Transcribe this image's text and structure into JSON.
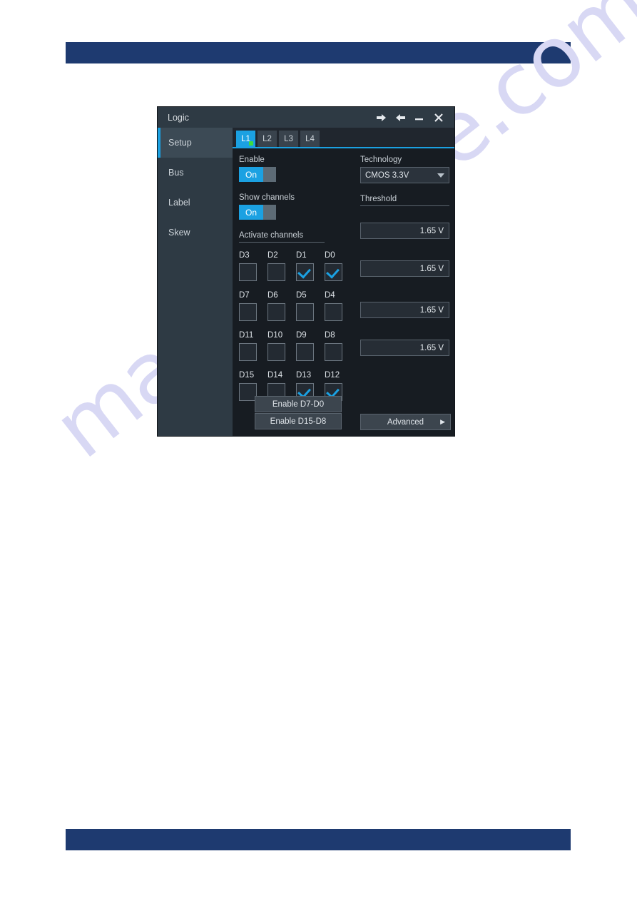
{
  "page": {
    "watermark": "manualshive.com",
    "bar_color": "#1e3a70"
  },
  "window": {
    "title": "Logic",
    "titlebar_buttons": [
      {
        "name": "back-arrow",
        "glyph": "←"
      },
      {
        "name": "forward-arrow",
        "glyph": "→"
      },
      {
        "name": "minimize",
        "glyph": "—"
      },
      {
        "name": "close",
        "glyph": "✕"
      }
    ]
  },
  "sidebar": {
    "items": [
      {
        "label": "Setup",
        "active": true
      },
      {
        "label": "Bus",
        "active": false
      },
      {
        "label": "Label",
        "active": false
      },
      {
        "label": "Skew",
        "active": false
      }
    ]
  },
  "tabs": [
    {
      "label": "L1",
      "active": true,
      "indicator": "green"
    },
    {
      "label": "L2",
      "active": false
    },
    {
      "label": "L3",
      "active": false
    },
    {
      "label": "L4",
      "active": false
    }
  ],
  "setup": {
    "enable": {
      "label": "Enable",
      "state": "On"
    },
    "show_channels": {
      "label": "Show channels",
      "state": "On"
    },
    "activate_channels_label": "Activate channels",
    "channel_rows": [
      [
        {
          "name": "D3",
          "checked": false
        },
        {
          "name": "D2",
          "checked": false
        },
        {
          "name": "D1",
          "checked": true
        },
        {
          "name": "D0",
          "checked": true
        }
      ],
      [
        {
          "name": "D7",
          "checked": false
        },
        {
          "name": "D6",
          "checked": false
        },
        {
          "name": "D5",
          "checked": false
        },
        {
          "name": "D4",
          "checked": false
        }
      ],
      [
        {
          "name": "D11",
          "checked": false
        },
        {
          "name": "D10",
          "checked": false
        },
        {
          "name": "D9",
          "checked": false
        },
        {
          "name": "D8",
          "checked": false
        }
      ],
      [
        {
          "name": "D15",
          "checked": false
        },
        {
          "name": "D14",
          "checked": false
        },
        {
          "name": "D13",
          "checked": true
        },
        {
          "name": "D12",
          "checked": true
        }
      ]
    ],
    "enable_low_button": "Enable D7-D0",
    "enable_high_button": "Enable D15-D8",
    "technology": {
      "label": "Technology",
      "value": "CMOS 3.3V"
    },
    "threshold": {
      "label": "Threshold",
      "values": [
        "1.65 V",
        "1.65 V",
        "1.65 V",
        "1.65 V"
      ]
    },
    "advanced_button": "Advanced",
    "advanced_arrow": "▶"
  },
  "colors": {
    "accent": "#1ba1e2",
    "indicator_green": "#3ddc3d",
    "window_bg": "#171c22",
    "sidebar_bg": "#2e3a44",
    "titlebar_bg": "#2e3a44"
  }
}
